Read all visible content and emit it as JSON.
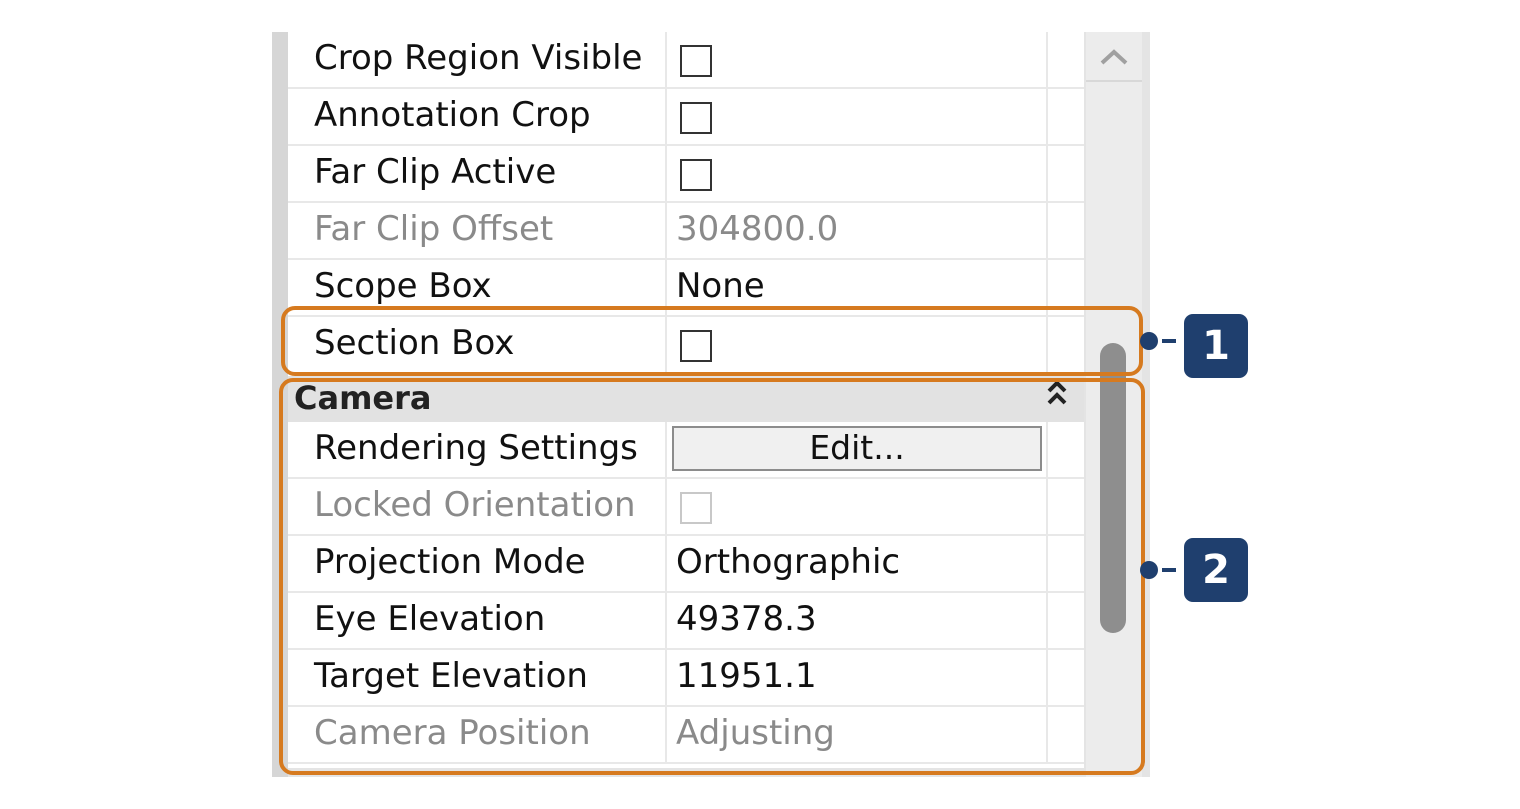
{
  "properties": {
    "rows_top": [
      {
        "name": "Crop Region Visible",
        "type": "checkbox",
        "checked": false,
        "disabled": false
      },
      {
        "name": "Annotation Crop",
        "type": "checkbox",
        "checked": false,
        "disabled": false
      },
      {
        "name": "Far Clip Active",
        "type": "checkbox",
        "checked": false,
        "disabled": false
      },
      {
        "name": "Far Clip Offset",
        "type": "text",
        "value": "304800.0",
        "disabled": true
      },
      {
        "name": "Scope Box",
        "type": "text",
        "value": "None",
        "disabled": false
      },
      {
        "name": "Section Box",
        "type": "checkbox",
        "checked": false,
        "disabled": false
      }
    ],
    "camera_group": {
      "title": "Camera",
      "collapse_icon": "double-chevron-up-icon",
      "rows": [
        {
          "name": "Rendering Settings",
          "type": "button",
          "value": "Edit...",
          "disabled": false
        },
        {
          "name": "Locked Orientation",
          "type": "checkbox",
          "checked": false,
          "disabled": true
        },
        {
          "name": "Projection Mode",
          "type": "text",
          "value": "Orthographic",
          "disabled": false
        },
        {
          "name": "Eye Elevation",
          "type": "text",
          "value": "49378.3",
          "disabled": false
        },
        {
          "name": "Target Elevation",
          "type": "text",
          "value": "11951.1",
          "disabled": false
        },
        {
          "name": "Camera Position",
          "type": "text",
          "value": "Adjusting",
          "disabled": true
        }
      ]
    }
  },
  "scrollbar": {
    "up_icon": "chevron-up-icon",
    "position": 0.55
  },
  "callouts": [
    "1",
    "2"
  ],
  "colors": {
    "highlight": "#d67a1f",
    "callout": "#1f3f6e"
  }
}
